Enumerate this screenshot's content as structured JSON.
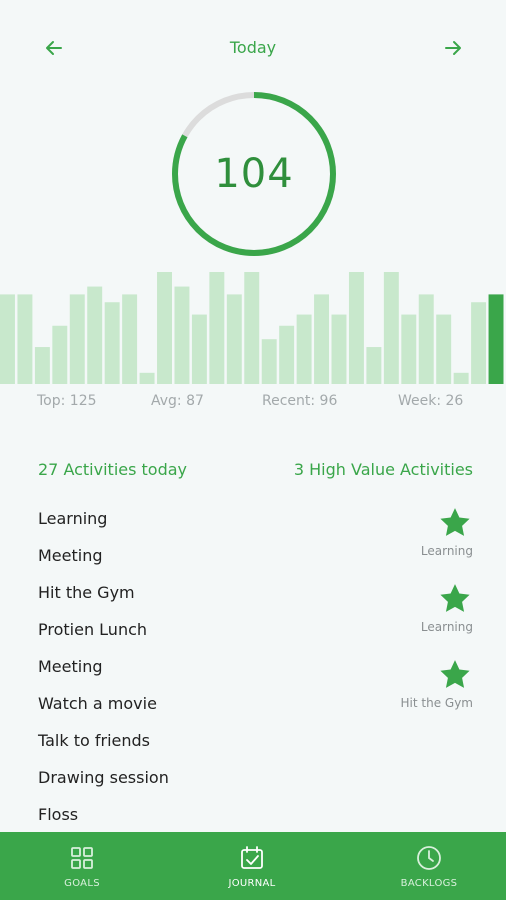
{
  "header": {
    "title": "Today",
    "prev_icon": "arrow-left-icon",
    "next_icon": "arrow-right-icon"
  },
  "score": {
    "value": "104",
    "progress_fraction": 0.83,
    "ring_color": "#3aa64a",
    "track_color": "#dcdcdc"
  },
  "history_chart": {
    "values": [
      80,
      80,
      33,
      52,
      80,
      87,
      73,
      80,
      10,
      100,
      87,
      62,
      100,
      80,
      100,
      40,
      52,
      62,
      80,
      62,
      100,
      33,
      100,
      62,
      80,
      62,
      10,
      73,
      80
    ],
    "highlight_index": 28,
    "bar_color": "#c8e8cc",
    "highlight_color": "#3aa64a"
  },
  "stats": {
    "top": "Top: 125",
    "avg": "Avg: 87",
    "recent": "Recent: 96",
    "week": "Week: 26"
  },
  "summary": {
    "activities_today": "27 Activities today",
    "high_value": "3 High Value Activities"
  },
  "activities": [
    "Learning",
    "Meeting",
    "Hit the Gym",
    "Protien Lunch",
    "Meeting",
    "Watch a movie",
    "Talk to friends",
    "Drawing session",
    "Floss"
  ],
  "high_value_items": [
    {
      "label": "Learning",
      "icon": "star-icon"
    },
    {
      "label": "Learning",
      "icon": "star-icon"
    },
    {
      "label": "Hit the Gym",
      "icon": "star-icon"
    }
  ],
  "bottom_nav": {
    "goals": "GOALS",
    "journal": "JOURNAL",
    "backlogs": "BACKLOGS",
    "active": "journal"
  },
  "colors": {
    "accent": "#3aa64a",
    "background": "#f4f8f8",
    "muted_text": "#a3a9ab"
  }
}
